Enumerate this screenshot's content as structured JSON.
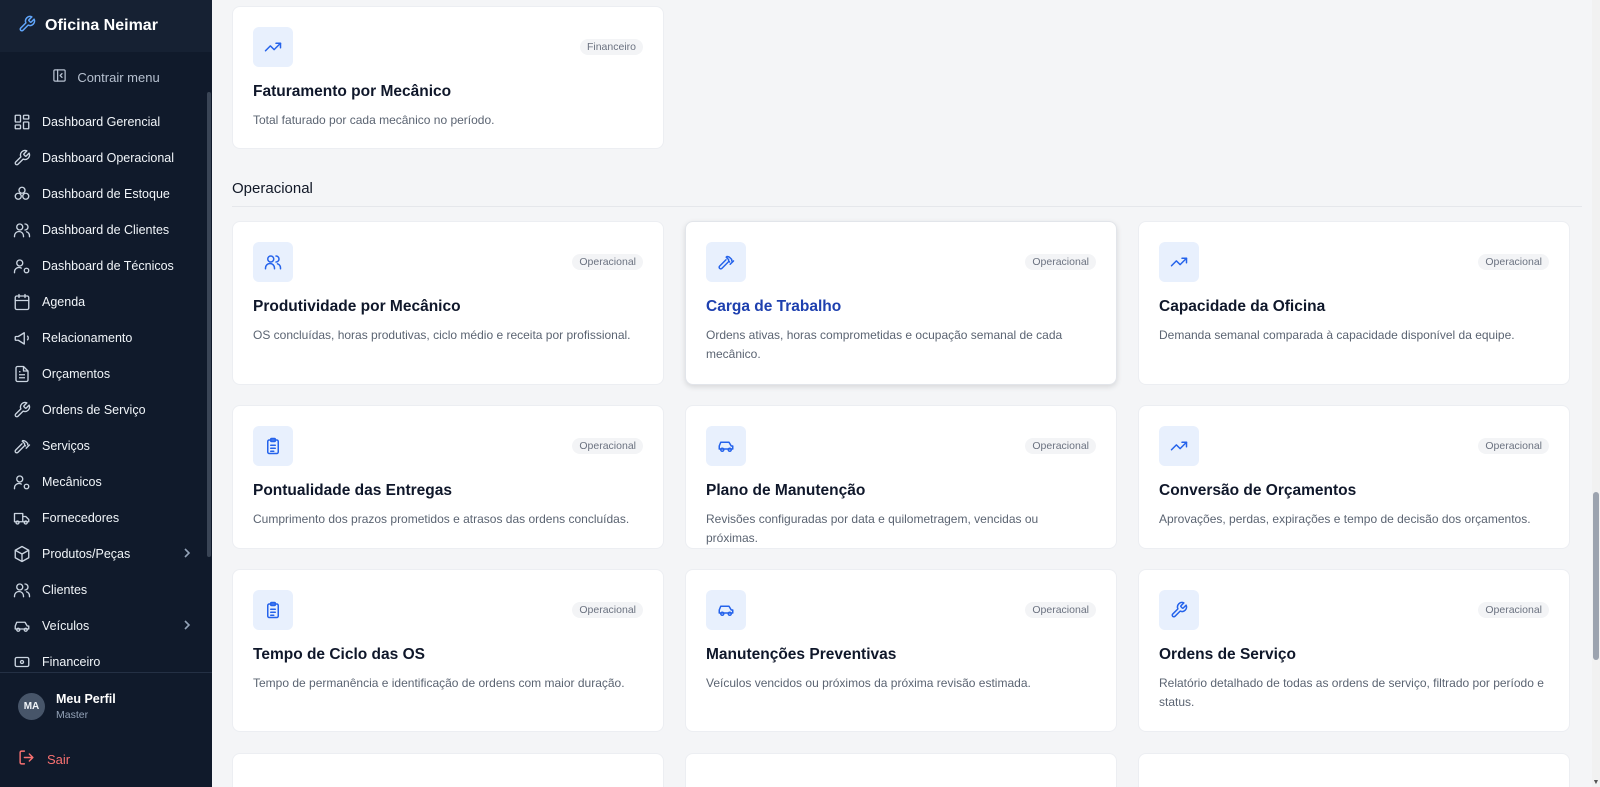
{
  "app": {
    "name": "Oficina Neimar"
  },
  "sidebar": {
    "collapse_label": "Contrair menu",
    "items": [
      {
        "label": "Dashboard Gerencial",
        "icon": "grid-icon"
      },
      {
        "label": "Dashboard Operacional",
        "icon": "wrench-icon"
      },
      {
        "label": "Dashboard de Estoque",
        "icon": "boxes-icon"
      },
      {
        "label": "Dashboard de Clientes",
        "icon": "users-icon"
      },
      {
        "label": "Dashboard de Técnicos",
        "icon": "user-gear-icon"
      },
      {
        "label": "Agenda",
        "icon": "calendar-icon"
      },
      {
        "label": "Relacionamento",
        "icon": "megaphone-icon"
      },
      {
        "label": "Orçamentos",
        "icon": "document-icon"
      },
      {
        "label": "Ordens de Serviço",
        "icon": "wrench-icon"
      },
      {
        "label": "Serviços",
        "icon": "hammer-icon"
      },
      {
        "label": "Mecânicos",
        "icon": "user-gear-icon"
      },
      {
        "label": "Fornecedores",
        "icon": "truck-icon"
      },
      {
        "label": "Produtos/Peças",
        "icon": "package-icon"
      },
      {
        "label": "Clientes",
        "icon": "users-icon"
      },
      {
        "label": "Veículos",
        "icon": "car-icon"
      },
      {
        "label": "Financeiro",
        "icon": "finance-icon"
      }
    ],
    "profile": {
      "initials": "MA",
      "name": "Meu Perfil",
      "role": "Master"
    },
    "logout_label": "Sair"
  },
  "top_card": {
    "badge": "Financeiro",
    "title": "Faturamento por Mecânico",
    "description": "Total faturado por cada mecânico no período.",
    "icon": "trending-up-icon"
  },
  "section": {
    "title": "Operacional"
  },
  "cards": [
    {
      "badge": "Operacional",
      "title": "Produtividade por Mecânico",
      "description": "OS concluídas, horas produtivas, ciclo médio e receita por profissional.",
      "icon": "users-icon"
    },
    {
      "badge": "Operacional",
      "title": "Carga de Trabalho",
      "description": "Ordens ativas, horas comprometidas e ocupação semanal de cada mecânico.",
      "icon": "hammer-icon"
    },
    {
      "badge": "Operacional",
      "title": "Capacidade da Oficina",
      "description": "Demanda semanal comparada à capacidade disponível da equipe.",
      "icon": "trending-up-icon"
    },
    {
      "badge": "Operacional",
      "title": "Pontualidade das Entregas",
      "description": "Cumprimento dos prazos prometidos e atrasos das ordens concluídas.",
      "icon": "clipboard-icon"
    },
    {
      "badge": "Operacional",
      "title": "Plano de Manutenção",
      "description": "Revisões configuradas por data e quilometragem, vencidas ou próximas.",
      "icon": "car-icon"
    },
    {
      "badge": "Operacional",
      "title": "Conversão de Orçamentos",
      "description": "Aprovações, perdas, expirações e tempo de decisão dos orçamentos.",
      "icon": "trending-up-icon"
    },
    {
      "badge": "Operacional",
      "title": "Tempo de Ciclo das OS",
      "description": "Tempo de permanência e identificação de ordens com maior duração.",
      "icon": "clipboard-icon"
    },
    {
      "badge": "Operacional",
      "title": "Manutenções Preventivas",
      "description": "Veículos vencidos ou próximos da próxima revisão estimada.",
      "icon": "car-icon"
    },
    {
      "badge": "Operacional",
      "title": "Ordens de Serviço",
      "description": "Relatório detalhado de todas as ordens de serviço, filtrado por período e status.",
      "icon": "wrench-icon"
    }
  ]
}
